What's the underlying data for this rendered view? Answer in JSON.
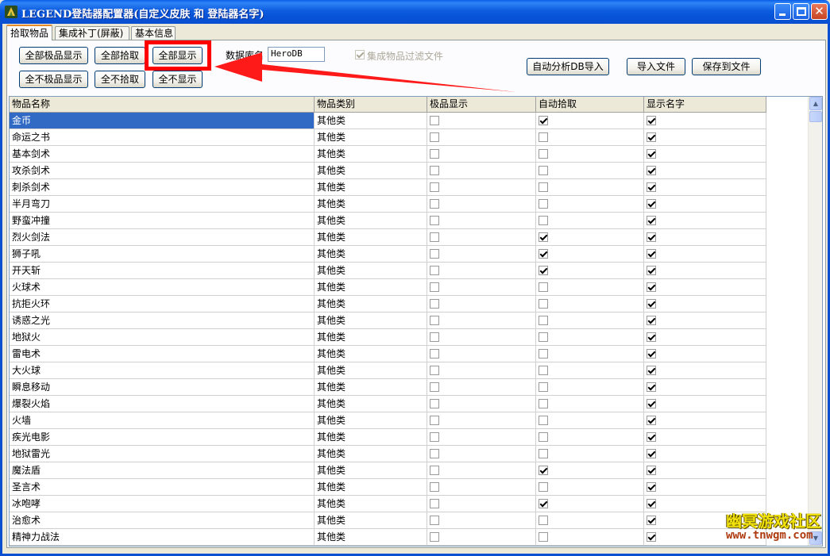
{
  "window": {
    "title": "LEGEND登陆器配置器(自定义皮肤 和 登陆器名字)",
    "colors": {
      "titlebar": "#0a5ee8",
      "selection": "#316ac5",
      "highlight": "#ff0000"
    }
  },
  "tabs": [
    {
      "label": "拾取物品",
      "active": true
    },
    {
      "label": "集成补丁(屏蔽)",
      "active": false
    },
    {
      "label": "基本信息",
      "active": false
    }
  ],
  "toolbar": {
    "all_premium_show": "全部极品显示",
    "all_pickup": "全部拾取",
    "all_show": "全部显示",
    "none_premium_show": "全不极品显示",
    "none_pickup": "全不拾取",
    "none_show": "全不显示",
    "db_label": "数据库名",
    "db_value": "HeroDB",
    "filter_label": "集成物品过滤文件",
    "filter_checked": true,
    "auto_import": "自动分析DB导入",
    "import_file": "导入文件",
    "save_file": "保存到文件"
  },
  "grid": {
    "columns": [
      "物品名称",
      "物品类别",
      "极品显示",
      "自动拾取",
      "显示名字"
    ],
    "rows": [
      {
        "name": "金币",
        "category": "其他类",
        "premium": false,
        "pickup": true,
        "show": true
      },
      {
        "name": "命运之书",
        "category": "其他类",
        "premium": false,
        "pickup": false,
        "show": true
      },
      {
        "name": "基本剑术",
        "category": "其他类",
        "premium": false,
        "pickup": false,
        "show": true
      },
      {
        "name": "攻杀剑术",
        "category": "其他类",
        "premium": false,
        "pickup": false,
        "show": true
      },
      {
        "name": "刺杀剑术",
        "category": "其他类",
        "premium": false,
        "pickup": false,
        "show": true
      },
      {
        "name": "半月弯刀",
        "category": "其他类",
        "premium": false,
        "pickup": false,
        "show": true
      },
      {
        "name": "野蛮冲撞",
        "category": "其他类",
        "premium": false,
        "pickup": false,
        "show": true
      },
      {
        "name": "烈火剑法",
        "category": "其他类",
        "premium": false,
        "pickup": true,
        "show": true
      },
      {
        "name": "狮子吼",
        "category": "其他类",
        "premium": false,
        "pickup": true,
        "show": true
      },
      {
        "name": "开天斩",
        "category": "其他类",
        "premium": false,
        "pickup": true,
        "show": true
      },
      {
        "name": "火球术",
        "category": "其他类",
        "premium": false,
        "pickup": false,
        "show": true
      },
      {
        "name": "抗拒火环",
        "category": "其他类",
        "premium": false,
        "pickup": false,
        "show": true
      },
      {
        "name": "诱惑之光",
        "category": "其他类",
        "premium": false,
        "pickup": false,
        "show": true
      },
      {
        "name": "地狱火",
        "category": "其他类",
        "premium": false,
        "pickup": false,
        "show": true
      },
      {
        "name": "雷电术",
        "category": "其他类",
        "premium": false,
        "pickup": false,
        "show": true
      },
      {
        "name": "大火球",
        "category": "其他类",
        "premium": false,
        "pickup": false,
        "show": true
      },
      {
        "name": "瞬息移动",
        "category": "其他类",
        "premium": false,
        "pickup": false,
        "show": true
      },
      {
        "name": "爆裂火焰",
        "category": "其他类",
        "premium": false,
        "pickup": false,
        "show": true
      },
      {
        "name": "火墙",
        "category": "其他类",
        "premium": false,
        "pickup": false,
        "show": true
      },
      {
        "name": "疾光电影",
        "category": "其他类",
        "premium": false,
        "pickup": false,
        "show": true
      },
      {
        "name": "地狱雷光",
        "category": "其他类",
        "premium": false,
        "pickup": false,
        "show": true
      },
      {
        "name": "魔法盾",
        "category": "其他类",
        "premium": false,
        "pickup": true,
        "show": true
      },
      {
        "name": "圣言术",
        "category": "其他类",
        "premium": false,
        "pickup": false,
        "show": true
      },
      {
        "name": "冰咆哮",
        "category": "其他类",
        "premium": false,
        "pickup": true,
        "show": true
      },
      {
        "name": "治愈术",
        "category": "其他类",
        "premium": false,
        "pickup": false,
        "show": true
      },
      {
        "name": "精神力战法",
        "category": "其他类",
        "premium": false,
        "pickup": false,
        "show": true
      }
    ]
  },
  "watermark": {
    "name_cn": "幽冥游戏社区",
    "url": "www.tnwgm.com"
  }
}
